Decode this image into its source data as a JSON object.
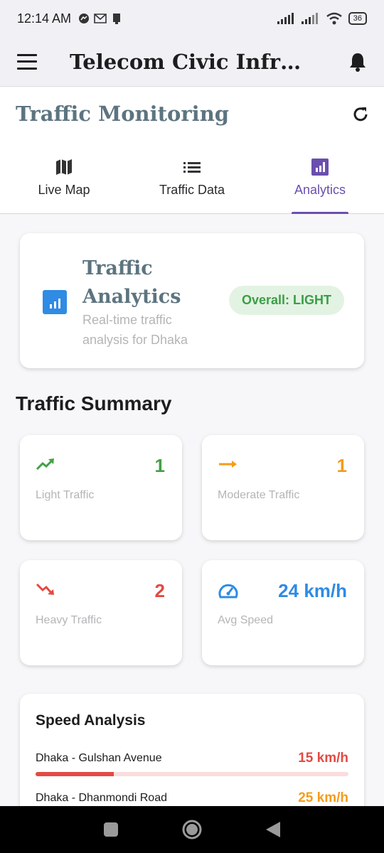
{
  "status_bar": {
    "time": "12:14 AM",
    "battery": "36"
  },
  "app_bar": {
    "title": "Telecom Civic Infrastr..."
  },
  "page": {
    "title": "Traffic Monitoring"
  },
  "tabs": [
    {
      "label": "Live Map",
      "icon": "map-icon"
    },
    {
      "label": "Traffic Data",
      "icon": "list-icon"
    },
    {
      "label": "Analytics",
      "icon": "analytics-icon",
      "active": true
    }
  ],
  "analytics_card": {
    "title": "Traffic Analytics",
    "subtitle": "Real-time traffic analysis for Dhaka",
    "overall": "Overall: LIGHT"
  },
  "summary": {
    "title": "Traffic Summary",
    "stats": [
      {
        "label": "Light Traffic",
        "value": "1",
        "color": "#43a047",
        "icon": "trending-up-icon"
      },
      {
        "label": "Moderate Traffic",
        "value": "1",
        "color": "#f59c1a",
        "icon": "arrow-right-icon"
      },
      {
        "label": "Heavy Traffic",
        "value": "2",
        "color": "#e34a42",
        "icon": "trending-down-icon"
      },
      {
        "label": "Avg Speed",
        "value": "24 km/h",
        "color": "#2f8be3",
        "icon": "speedometer-icon"
      }
    ]
  },
  "speed_analysis": {
    "title": "Speed Analysis",
    "rows": [
      {
        "name": "Dhaka - Gulshan Avenue",
        "value": "15 km/h",
        "color": "#e34a42",
        "fill": 0.25
      },
      {
        "name": "Dhaka - Dhanmondi Road",
        "value": "25 km/h",
        "color": "#f59c1a",
        "fill": 0.42
      }
    ]
  },
  "colors": {
    "accent": "#6a4fad",
    "title_slate": "#5d7480"
  }
}
